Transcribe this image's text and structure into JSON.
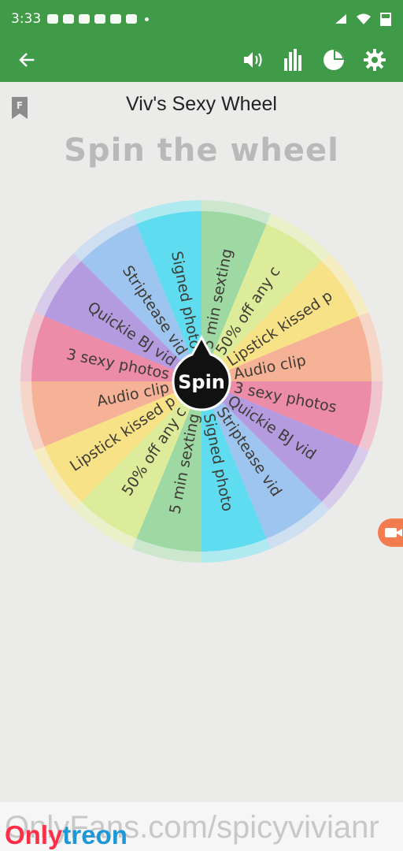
{
  "status_bar": {
    "time": "3:33"
  },
  "app_bar": {
    "back_icon": "arrow-left-icon",
    "actions": [
      "volume-icon",
      "bar-chart-icon",
      "pie-chart-icon",
      "settings-icon"
    ]
  },
  "wheel": {
    "title": "Viv's Sexy Wheel",
    "heading": "Spin the wheel",
    "spin_label": "Spin",
    "segments": [
      {
        "label": "5 min sexting",
        "color": "#9ed8a3"
      },
      {
        "label": "50% off any c",
        "color": "#dcec9a"
      },
      {
        "label": "Lipstick kissed p",
        "color": "#f8e288"
      },
      {
        "label": "Audio clip",
        "color": "#f6b296"
      },
      {
        "label": "3 sexy photos",
        "color": "#ec8ca9"
      },
      {
        "label": "Quickie BJ vid",
        "color": "#b49be0"
      },
      {
        "label": "Striptease vid",
        "color": "#9ec5ef"
      },
      {
        "label": "Signed photo",
        "color": "#5fdcef"
      },
      {
        "label": "5 min sexting",
        "color": "#9ed8a3"
      },
      {
        "label": "50% off any c",
        "color": "#dcec9a"
      },
      {
        "label": "Lipstick kissed p",
        "color": "#f8e288"
      },
      {
        "label": "Audio clip",
        "color": "#f6b296"
      },
      {
        "label": "3 sexy photos",
        "color": "#ec8ca9"
      },
      {
        "label": "Quickie BJ vid",
        "color": "#b49be0"
      },
      {
        "label": "Striptease vid",
        "color": "#9ec5ef"
      },
      {
        "label": "Signed photo",
        "color": "#5fdcef"
      }
    ]
  },
  "footer": {
    "url_text": "OnlyFans.com/spicyvivianr"
  },
  "watermark": {
    "part1": "Only",
    "part2": "treon"
  }
}
